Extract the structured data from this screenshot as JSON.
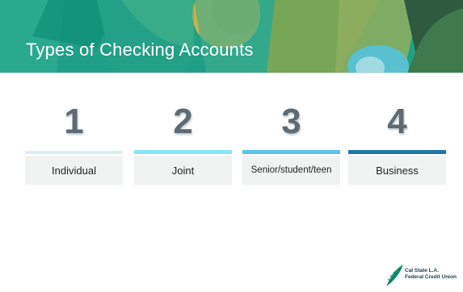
{
  "slide": {
    "title": "Types of Checking Accounts",
    "items": [
      {
        "number": "1",
        "label": "Individual"
      },
      {
        "number": "2",
        "label": "Joint"
      },
      {
        "number": "3",
        "label": "Senior/student/teen"
      },
      {
        "number": "4",
        "label": "Business"
      }
    ]
  },
  "logo": {
    "line1": "Cal State L.A.",
    "line2": "Federal Credit Union"
  },
  "colors": {
    "banner_green": "#1aa388",
    "bar_1": "#d7f0f6",
    "bar_2": "#87e6f2",
    "bar_3": "#5bc4ec",
    "bar_4": "#1f77a6"
  }
}
